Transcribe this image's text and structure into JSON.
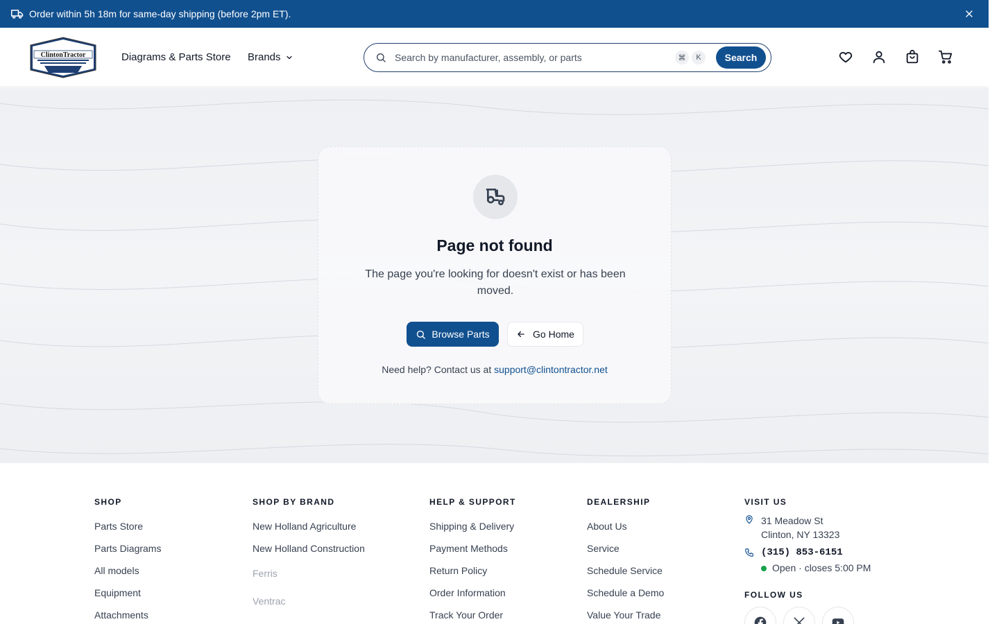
{
  "promo": {
    "text": "Order within 5h 18m for same-day shipping (before 2pm ET).",
    "icon": "truck-icon",
    "close_icon": "close-icon"
  },
  "header": {
    "logo_text": "ClintonTractor",
    "nav": {
      "diagrams": "Diagrams & Parts Store",
      "brands": "Brands"
    },
    "search": {
      "placeholder": "Search by manufacturer, assembly, or parts",
      "value": "",
      "shortcut_cmd": "⌘",
      "shortcut_key": "K",
      "button": "Search"
    },
    "icons": [
      "heart-icon",
      "user-icon",
      "shopping-bag-icon",
      "cart-icon"
    ]
  },
  "not_found": {
    "icon": "tractor-icon",
    "title": "Page not found",
    "description": "The page you're looking for doesn't exist or has been moved.",
    "browse_button": "Browse Parts",
    "home_button": "Go Home",
    "help_text": "Need help? Contact us at",
    "help_email": "support@clintontractor.net"
  },
  "footer": {
    "shop": {
      "heading": "SHOP",
      "links": [
        "Parts Store",
        "Parts Diagrams",
        "All models",
        "Equipment",
        "Attachments"
      ]
    },
    "brands": {
      "heading": "SHOP BY BRAND",
      "links": [
        "New Holland Agriculture",
        "New Holland Construction"
      ],
      "muted": [
        "Ferris",
        "Ventrac"
      ]
    },
    "help": {
      "heading": "HELP & SUPPORT",
      "links": [
        "Shipping & Delivery",
        "Payment Methods",
        "Return Policy",
        "Order Information",
        "Track Your Order"
      ]
    },
    "dealership": {
      "heading": "DEALERSHIP",
      "links": [
        "About Us",
        "Service",
        "Schedule Service",
        "Schedule a Demo",
        "Value Your Trade"
      ]
    },
    "visit": {
      "heading": "VISIT US",
      "address_line1": "31 Meadow St",
      "address_line2": "Clinton, NY 13323",
      "phone": "(315) 853-6151",
      "hours": "Open · closes 5:00 PM",
      "follow_heading": "FOLLOW US",
      "social": [
        "facebook-icon",
        "x-icon",
        "youtube-icon"
      ]
    }
  },
  "colors": {
    "brand_blue": "#11508f",
    "open_green": "#16a34a"
  }
}
